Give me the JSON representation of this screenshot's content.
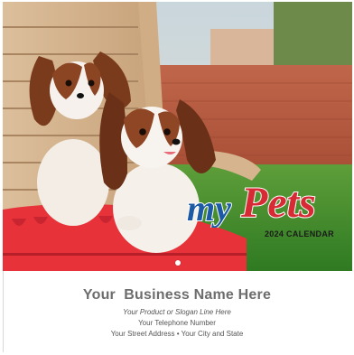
{
  "calendar": {
    "brand_part1": "my",
    "brand_part2": "Pets",
    "year_line": "2024 CALENDAR",
    "colors": {
      "brand_blue": "#1c5aa6",
      "brand_red": "#d62a35",
      "chair_red": "#e8323a",
      "grass": "#3f8c2a"
    }
  },
  "imprint": {
    "business_name": "Your  Business Name Here",
    "slogan": "Your Product or Slogan Line Here",
    "phone": "Your Telephone Number",
    "address": "Your Street Address • Your City and State"
  }
}
